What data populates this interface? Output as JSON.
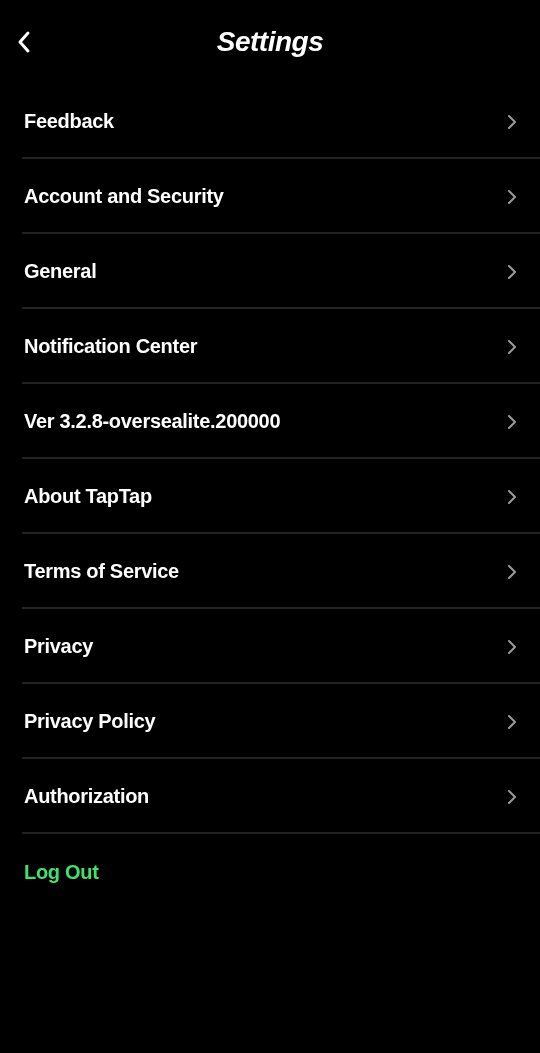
{
  "header": {
    "title": "Settings"
  },
  "items": [
    {
      "kind": "link",
      "label": "Feedback"
    },
    {
      "kind": "link",
      "label": "Account and Security"
    },
    {
      "kind": "link",
      "label": "General"
    },
    {
      "kind": "link",
      "label": "Notification Center"
    },
    {
      "kind": "link",
      "label": "Ver 3.2.8-oversealite.200000"
    },
    {
      "kind": "link",
      "label": "About TapTap"
    },
    {
      "kind": "link",
      "label": "Terms of Service"
    },
    {
      "kind": "link",
      "label": "Privacy"
    },
    {
      "kind": "link",
      "label": "Privacy Policy"
    },
    {
      "kind": "link",
      "label": "Authorization"
    },
    {
      "kind": "action",
      "label": "Log Out"
    }
  ]
}
